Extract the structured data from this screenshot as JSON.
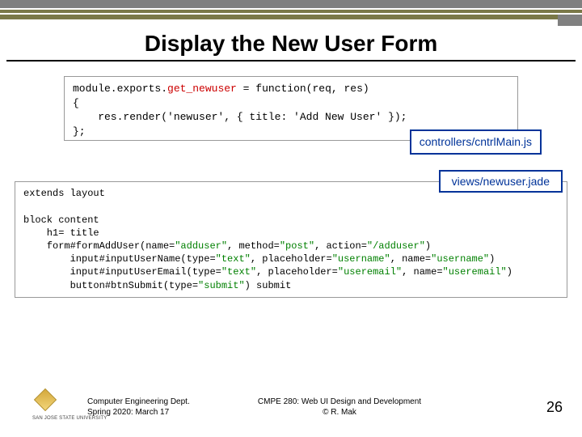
{
  "title": "Display the New User Form",
  "code1": {
    "l1a": "module.exports.",
    "l1b": "get_newuser",
    "l1c": " = function(req, res)",
    "l2": "{",
    "l3": "    res.render('newuser', { title: 'Add New User' });",
    "l4": "};"
  },
  "badge1": "controllers/cntrlMain.js",
  "badge2": "views/newuser.jade",
  "code2": {
    "l1": "extends layout",
    "blank": " ",
    "l2": "block content",
    "l3": "    h1= title",
    "l4a": "    form#formAddUser(name=",
    "l4b": "\"adduser\"",
    "l4c": ", method=",
    "l4d": "\"post\"",
    "l4e": ", action=",
    "l4f": "\"/adduser\"",
    "l4g": ")",
    "l5a": "        input#inputUserName(type=",
    "l5b": "\"text\"",
    "l5c": ", placeholder=",
    "l5d": "\"username\"",
    "l5e": ", name=",
    "l5f": "\"username\"",
    "l5g": ")",
    "l6a": "        input#inputUserEmail(type=",
    "l6b": "\"text\"",
    "l6c": ", placeholder=",
    "l6d": "\"useremail\"",
    "l6e": ", name=",
    "l6f": "\"useremail\"",
    "l6g": ")",
    "l7a": "        button#btnSubmit(type=",
    "l7b": "\"submit\"",
    "l7c": ") submit"
  },
  "footer": {
    "sjsu": "SAN JOSE STATE UNIVERSITY",
    "dept1": "Computer Engineering Dept.",
    "dept2": "Spring 2020: March 17",
    "course1": "CMPE 280: Web UI Design and Development",
    "course2": "© R. Mak",
    "page": "26"
  }
}
